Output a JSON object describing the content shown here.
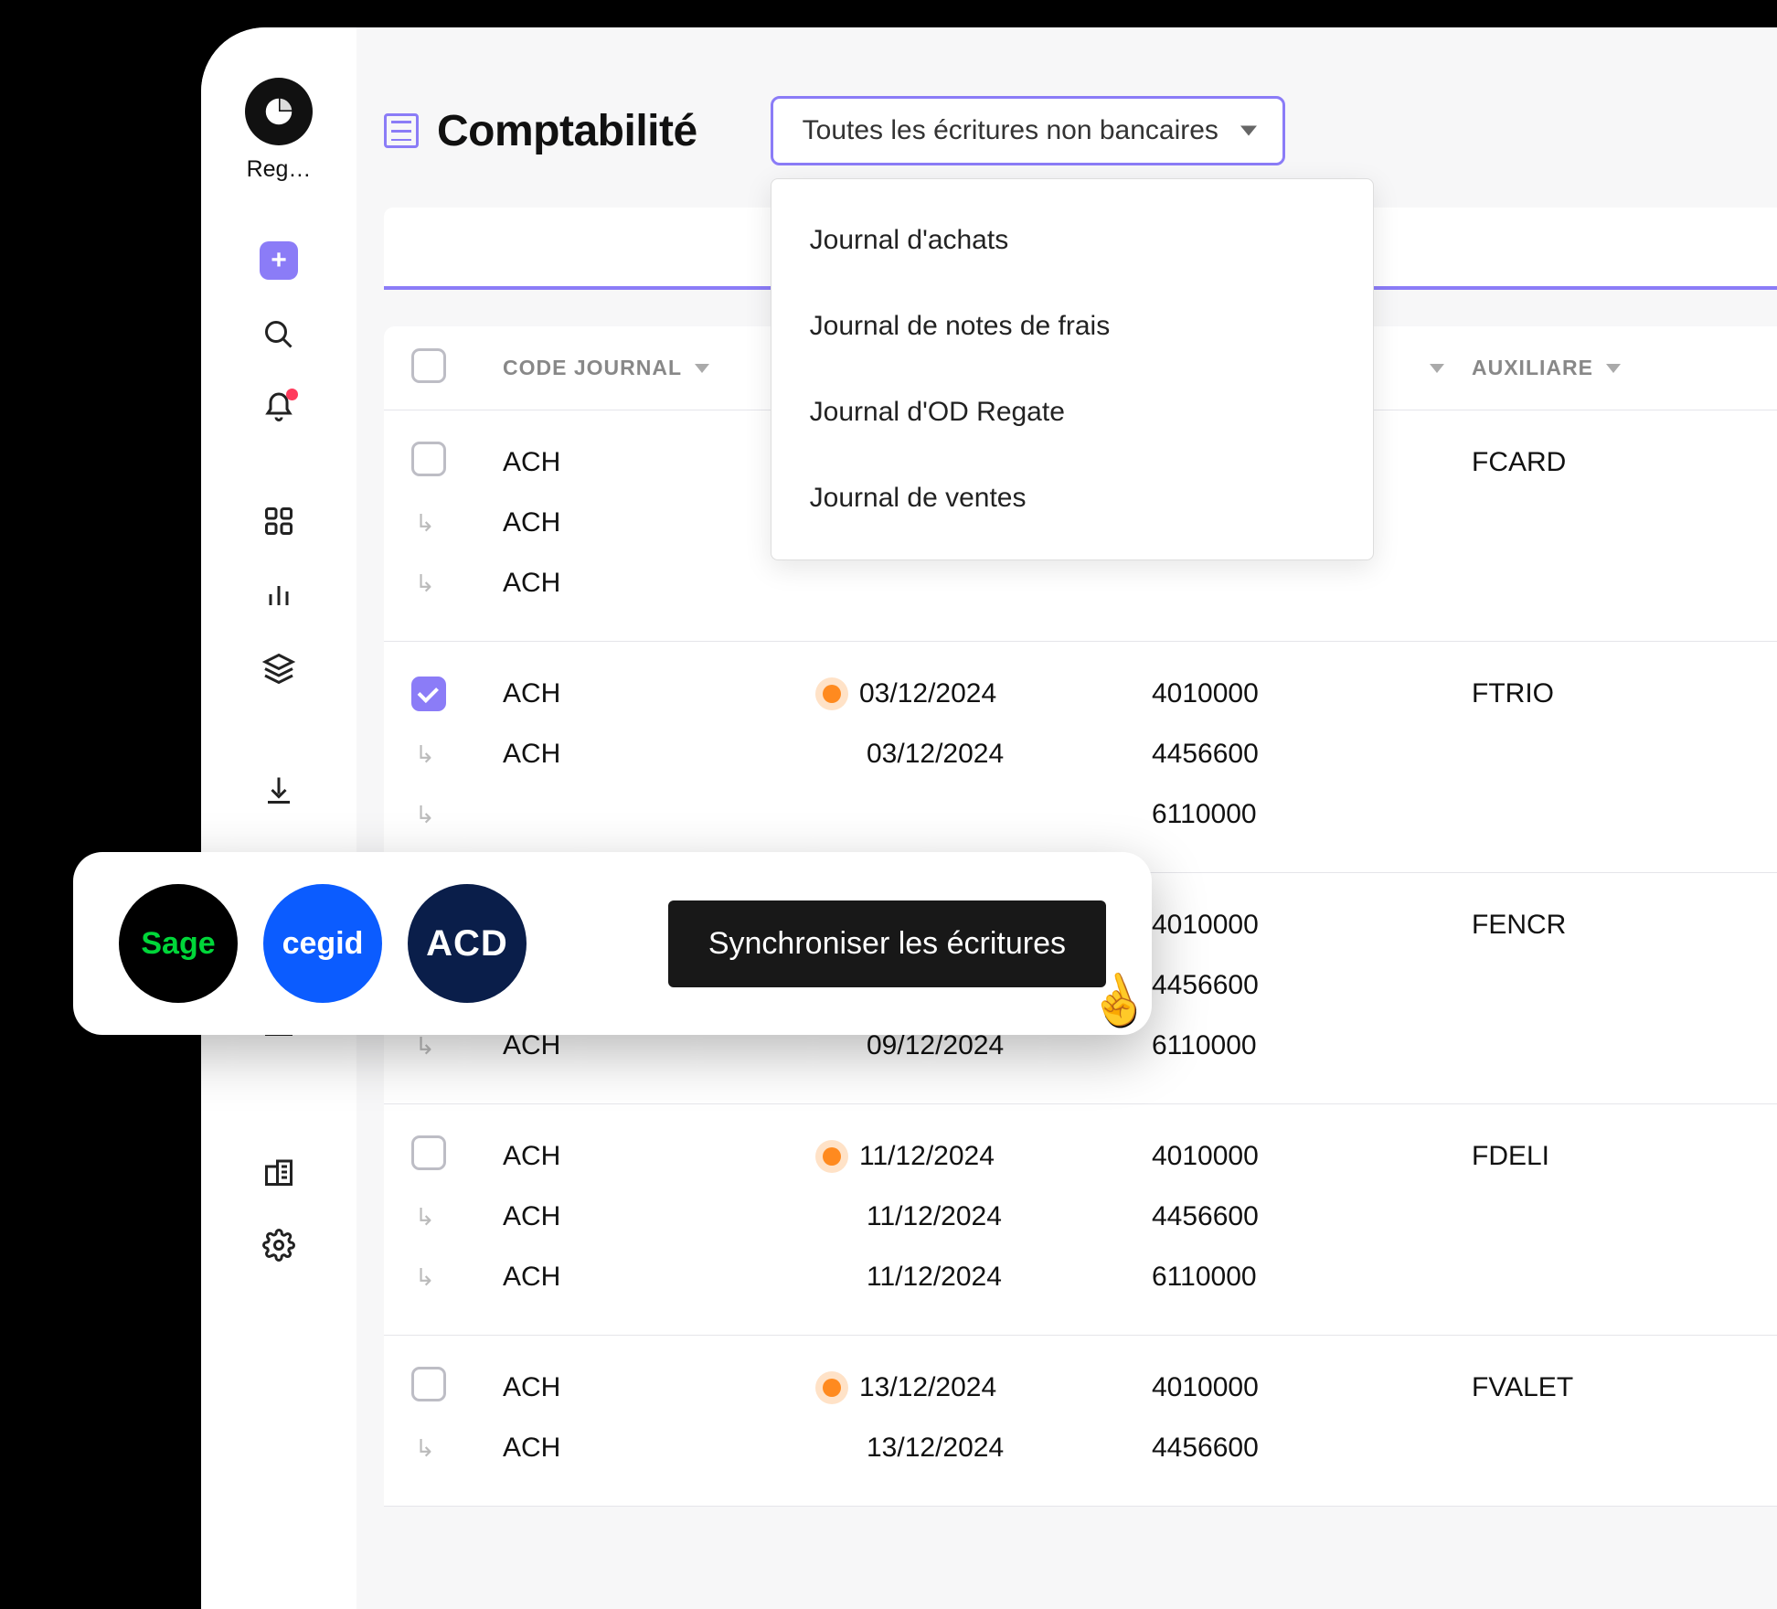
{
  "sidebar": {
    "logo_label": "Reg…"
  },
  "header": {
    "page_title": "Comptabilité"
  },
  "filter": {
    "selected_label": "Toutes les écritures non bancaires",
    "options": [
      "Journal d'achats",
      "Journal de notes de frais",
      "Journal d'OD Regate",
      "Journal de ventes"
    ]
  },
  "columns": {
    "code": "CODE JOURNAL",
    "aux": "AUXILIARE"
  },
  "groups": [
    {
      "checked": false,
      "aux": "FCARD",
      "rows": [
        {
          "code": "ACH",
          "date": "",
          "account": "",
          "is_child": false
        },
        {
          "code": "ACH",
          "date": "",
          "account": "",
          "is_child": true
        },
        {
          "code": "ACH",
          "date": "",
          "account": "",
          "is_child": true
        }
      ]
    },
    {
      "checked": true,
      "aux": "FTRIO",
      "rows": [
        {
          "code": "ACH",
          "date": "03/12/2024",
          "account": "4010000",
          "is_child": false,
          "dot": true
        },
        {
          "code": "ACH",
          "date": "03/12/2024",
          "account": "4456600",
          "is_child": true
        },
        {
          "code": "",
          "date": "",
          "account": "6110000",
          "is_child": true,
          "blank_code": true
        }
      ]
    },
    {
      "checked": false,
      "aux": "FENCR",
      "rows": [
        {
          "code": "",
          "date": "",
          "account": "4010000",
          "is_child": false,
          "blank_code": true
        },
        {
          "code": "ACH",
          "date": "09/12/2024",
          "account": "4456600",
          "is_child": true
        },
        {
          "code": "ACH",
          "date": "09/12/2024",
          "account": "6110000",
          "is_child": true
        }
      ]
    },
    {
      "checked": false,
      "aux": "FDELI",
      "rows": [
        {
          "code": "ACH",
          "date": "11/12/2024",
          "account": "4010000",
          "is_child": false,
          "dot": true
        },
        {
          "code": "ACH",
          "date": "11/12/2024",
          "account": "4456600",
          "is_child": true
        },
        {
          "code": "ACH",
          "date": "11/12/2024",
          "account": "6110000",
          "is_child": true
        }
      ]
    },
    {
      "checked": false,
      "aux": "FVALET",
      "rows": [
        {
          "code": "ACH",
          "date": "13/12/2024",
          "account": "4010000",
          "is_child": false,
          "dot": true
        },
        {
          "code": "ACH",
          "date": "13/12/2024",
          "account": "4456600",
          "is_child": true
        }
      ]
    }
  ],
  "sync": {
    "button_label": "Synchroniser les écritures",
    "integrations": {
      "sage": "Sage",
      "cegid": "cegid",
      "acd": "ACD"
    }
  }
}
